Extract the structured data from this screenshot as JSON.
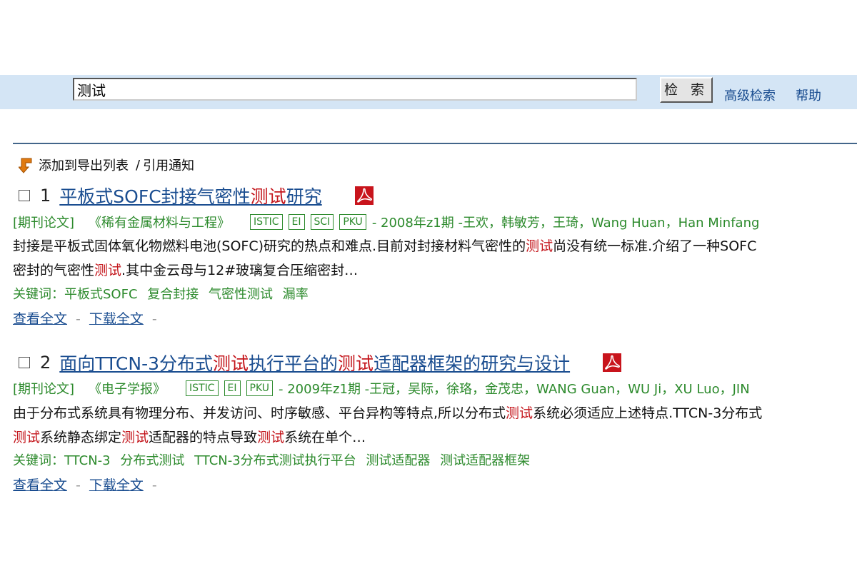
{
  "search": {
    "query": "测试",
    "button_label": "检 索",
    "advanced_label": "高级检索",
    "help_label": "帮助"
  },
  "toolbar": {
    "export_label": "添加到导出列表",
    "separator": "/",
    "cite_label": "引用通知"
  },
  "results": [
    {
      "number": "1",
      "title_parts": [
        "平板式SOFC封接气密性",
        "测试",
        "研究"
      ],
      "type": "[期刊论文]",
      "source": "《稀有金属材料与工程》",
      "tags": [
        "ISTIC",
        "EI",
        "SCI",
        "PKU"
      ],
      "info": "- 2008年z1期 -王欢，韩敏芳，王琦，Wang Huan，Han Minfang",
      "abstract_line1": [
        "封接是平板式固体氧化物燃料电池(SOFC)研究的热点和难点.目前对封接材料气密性的",
        "测试",
        "尚没有统一标准.介绍了一种SOFC"
      ],
      "abstract_line2": [
        "密封的气密性",
        "测试",
        ".其中金云母与12#玻璃复合压缩密封…"
      ],
      "keywords_label": "关键词：",
      "keywords": [
        "平板式SOFC",
        "复合封接",
        "气密性测试",
        "漏率"
      ],
      "view_label": "查看全文",
      "download_label": "下载全文",
      "dash": "-"
    },
    {
      "number": "2",
      "title_parts": [
        "面向TTCN-3分布式",
        "测试",
        "执行平台的",
        "测试",
        "适配器框架的研究与设计"
      ],
      "type": "[期刊论文]",
      "source": "《电子学报》",
      "tags": [
        "ISTIC",
        "EI",
        "PKU"
      ],
      "info": "- 2009年z1期 -王冠，吴际，徐珞，金茂忠，WANG Guan，WU Ji，XU Luo，JIN",
      "abstract_line1": [
        "由于分布式系统具有物理分布、并发访问、时序敏感、平台异构等特点,所以分布式",
        "测试",
        "系统必须适应上述特点.TTCN-3分布式"
      ],
      "abstract_line2": [
        "",
        "测试",
        "系统静态绑定",
        "测试",
        "适配器的特点导致",
        "测试",
        "系统在单个…"
      ],
      "keywords_label": "关键词：",
      "keywords": [
        "TTCN-3",
        "分布式测试",
        "TTCN-3分布式测试执行平台",
        "测试适配器",
        "测试适配器框架"
      ],
      "view_label": "查看全文",
      "download_label": "下载全文",
      "dash": "-"
    }
  ]
}
